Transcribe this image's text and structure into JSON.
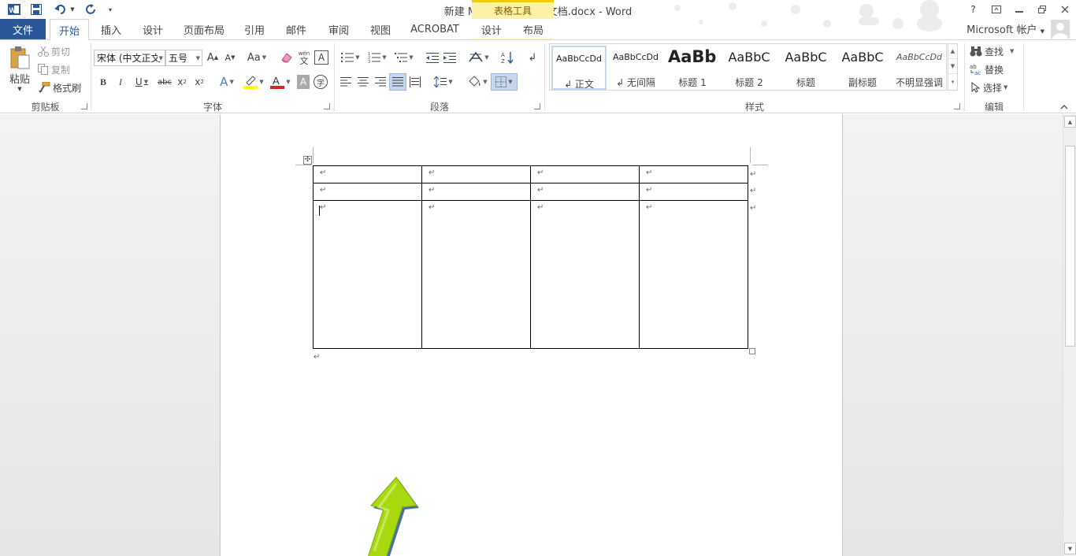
{
  "window": {
    "title": "新建 Microsoft Word 文档.docx - Word",
    "help": "?",
    "account": "Microsoft 帐户"
  },
  "contextual": {
    "header": "表格工具"
  },
  "tabs": [
    {
      "label": "文件"
    },
    {
      "label": "开始"
    },
    {
      "label": "插入"
    },
    {
      "label": "设计"
    },
    {
      "label": "页面布局"
    },
    {
      "label": "引用"
    },
    {
      "label": "邮件"
    },
    {
      "label": "审阅"
    },
    {
      "label": "视图"
    },
    {
      "label": "ACROBAT"
    },
    {
      "label": "设计"
    },
    {
      "label": "布局"
    }
  ],
  "ribbon": {
    "clipboard": {
      "paste": "粘贴",
      "cut": "剪切",
      "copy": "复制",
      "format_painter": "格式刷",
      "group": "剪贴板"
    },
    "font": {
      "font_name": "宋体 (中文正文",
      "font_size": "五号",
      "change_case": "Aa",
      "group": "字体"
    },
    "paragraph": {
      "group": "段落"
    },
    "styles": {
      "items": [
        {
          "sample": "AaBbCcDd",
          "name": "↲ 正文"
        },
        {
          "sample": "AaBbCcDd",
          "name": "↲ 无间隔"
        },
        {
          "sample": "AaBb",
          "name": "标题 1"
        },
        {
          "sample": "AaBbC",
          "name": "标题 2"
        },
        {
          "sample": "AaBbC",
          "name": "标题"
        },
        {
          "sample": "AaBbC",
          "name": "副标题"
        },
        {
          "sample": "AaBbCcDd",
          "name": "不明显强调"
        }
      ],
      "group": "样式"
    },
    "editing": {
      "find": "查找",
      "replace": "替换",
      "select": "选择",
      "group": "编辑"
    }
  },
  "document": {
    "para_mark": "↵",
    "table": {
      "rows": [
        [
          "↵",
          "↵",
          "↵",
          "↵"
        ],
        [
          "↵",
          "↵",
          "↵",
          "↵"
        ],
        [
          "↵",
          "↵",
          "↵",
          "↵"
        ]
      ]
    }
  },
  "colors": {
    "brand": "#2b579a",
    "contextual_tab": "#fdf1a7",
    "arrow": "#9fd41a"
  }
}
